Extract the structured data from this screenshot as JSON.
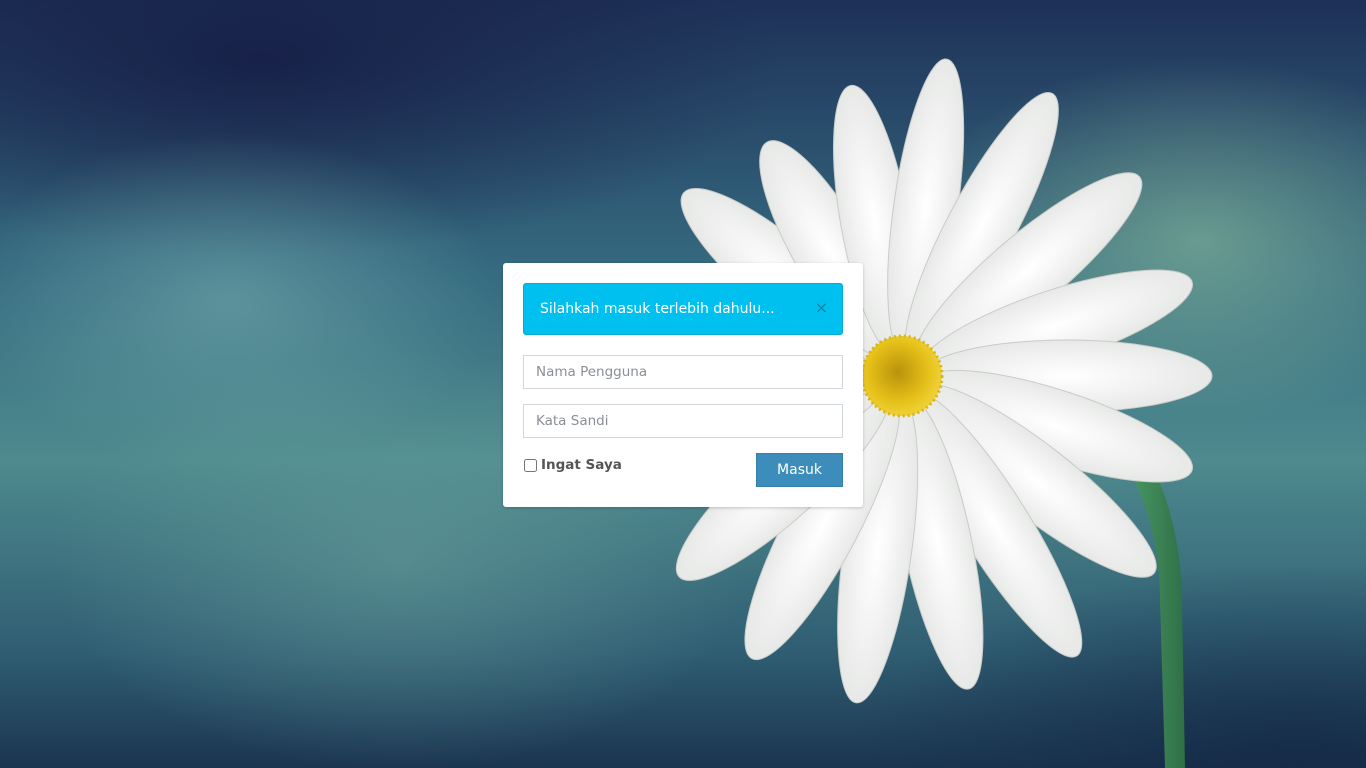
{
  "alert": {
    "message": "Silahkah masuk terlebih dahulu...",
    "close_symbol": "×"
  },
  "form": {
    "username_placeholder": "Nama Pengguna",
    "username_value": "",
    "password_placeholder": "Kata Sandi",
    "password_value": "",
    "remember_label": "Ingat Saya",
    "remember_checked": false,
    "submit_label": "Masuk"
  },
  "colors": {
    "alert_bg": "#00c0ef",
    "button_bg": "#3c8dbc",
    "flower_center": "#e8c21a",
    "petal": "#f4f4f2",
    "stem": "#3f8a5a"
  }
}
